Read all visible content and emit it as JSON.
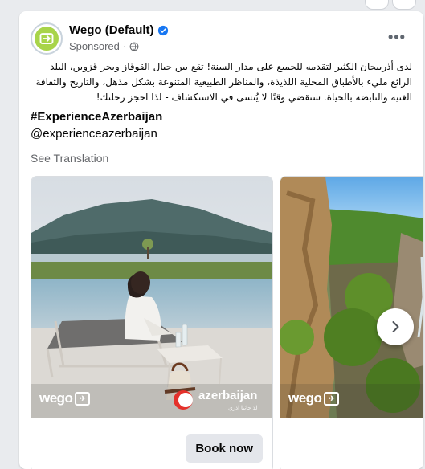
{
  "post": {
    "page_name": "Wego (Default)",
    "sponsored_label": "Sponsored",
    "more_label": "•••",
    "body_text": "لدى أذربيجان الكثير لتقدمه للجميع على مدار السنة! تقع بين جبال القوقاز وبحر قزوين، البلد الرائع مليء بالأطباق المحلية اللذيذة، والمناظر الطبيعية المتنوعة بشكل مذهل، والتاريخ والثقافة الغنية والنابضة بالحياة. ستقضي وقتًا لا يُنسى في الاستكشاف - لذا احجز رحلتك!",
    "hashtag": "#ExperienceAzerbaijan",
    "handle": "@experienceazerbaijan",
    "see_translation": "See Translation"
  },
  "carousel": {
    "cards": [
      {
        "brand_logo_text": "wego",
        "partner_logo_text": "azerbaijan",
        "partner_logo_subtext": "لذ جانبا اذري",
        "cta_label": "Book now"
      },
      {
        "brand_logo_text": "wego"
      }
    ],
    "next_icon": "chevron-right-icon"
  },
  "colors": {
    "accent_blue": "#1877f2",
    "wego_green": "#a8d44a",
    "text_secondary": "#65676b",
    "button_gray": "#e4e6eb",
    "azerbaijan_red": "#e4312b"
  }
}
